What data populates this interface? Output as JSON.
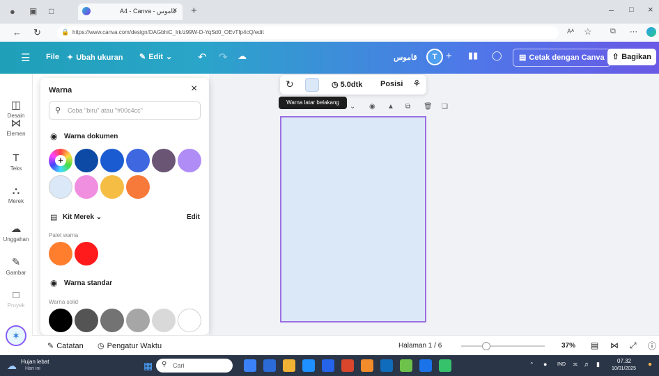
{
  "browser": {
    "tab_title": "A4 - Canva - قاموس",
    "url": "https://www.canva.com/design/DAGbhiC_lrk/z99W-D-YqSd0_OEvTfp4cQ/edit",
    "zoom_badge": "Aᴬ"
  },
  "topbar": {
    "file": "File",
    "resize": "Ubah ukuran",
    "edit": "Edit",
    "title": "قاموس",
    "avatar": "T",
    "print": "Cetak dengan Canva",
    "share": "Bagikan"
  },
  "rail": [
    {
      "icon": "layout-icon",
      "label": "Desain"
    },
    {
      "icon": "elements-icon",
      "label": "Elemen"
    },
    {
      "icon": "text-icon",
      "label": "Teks"
    },
    {
      "icon": "brand-icon",
      "label": "Merek"
    },
    {
      "icon": "upload-icon",
      "label": "Unggahan"
    },
    {
      "icon": "draw-icon",
      "label": "Gambar"
    },
    {
      "icon": "folder-icon",
      "label": "Proyek"
    }
  ],
  "panel": {
    "title": "Warna",
    "search_placeholder": "Coba \"biru\" atau \"#00c4cc\"",
    "doc_colors_title": "Warna dokumen",
    "kit_title": "Kit Merek",
    "kit_edit": "Edit",
    "palette_label": "Palet warna",
    "standard_title": "Warna standar",
    "solid_label": "Warna solid",
    "doc_colors": [
      "#0d4aa6",
      "#1b5bd1",
      "#3f67e0",
      "#6b5575",
      "#b08cf6",
      "#dbe8f8",
      "#f08ee0",
      "#f6bd45",
      "#f77a3a"
    ],
    "palette": [
      "#ff7e2e",
      "#ff1b1b"
    ],
    "solid": [
      "#000000",
      "#545454",
      "#737373",
      "#a6a6a6",
      "#d9d9d9",
      "#ffffff"
    ]
  },
  "context_toolbar": {
    "duration": "5.0dtk",
    "position": "Posisi",
    "tooltip": "Warna latar belakang",
    "page_label": "Halaman 1"
  },
  "bottombar": {
    "notes": "Catatan",
    "timer": "Pengatur Waktu",
    "page_counter": "Halaman 1 / 6",
    "zoom": "37%"
  },
  "taskbar": {
    "weather_title": "Hujan lebat",
    "weather_sub": "Hari ini",
    "search": "Cari",
    "lang": "IND",
    "time": "07.32",
    "date": "10/01/2025"
  }
}
